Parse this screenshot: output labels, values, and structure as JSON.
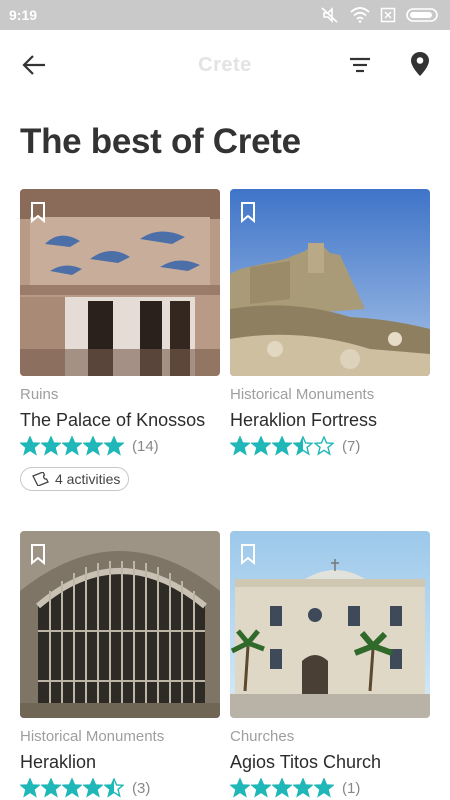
{
  "status_bar": {
    "time": "9:19"
  },
  "app_bar": {
    "title": "Crete"
  },
  "page": {
    "title": "The best of Crete"
  },
  "colors": {
    "star": "#1fb7b7",
    "status_bar": "#c9c9c9"
  },
  "cards": [
    {
      "category": "Ruins",
      "name": "The Palace of Knossos",
      "rating": 5,
      "count": "(14)",
      "activities": "4 activities"
    },
    {
      "category": "Historical Monuments",
      "name": "Heraklion Fortress",
      "rating": 3.5,
      "count": "(7)"
    },
    {
      "category": "Historical Monuments",
      "name": "Heraklion",
      "rating": 4.5,
      "count": "(3)"
    },
    {
      "category": "Churches",
      "name": "Agios Titos Church",
      "rating": 5,
      "count": "(1)"
    }
  ]
}
